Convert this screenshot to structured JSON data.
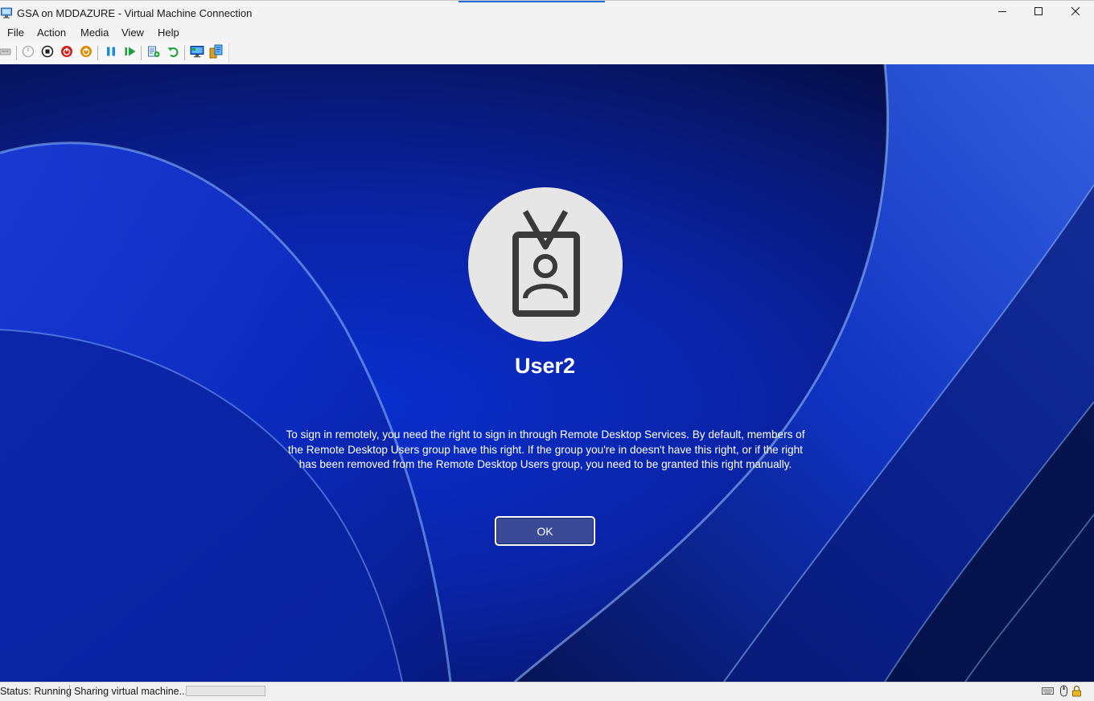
{
  "window": {
    "title": "GSA on MDDAZURE - Virtual Machine Connection",
    "controls": [
      "minimize-icon",
      "maximize-icon",
      "close-icon"
    ]
  },
  "menu": {
    "items": [
      "File",
      "Action",
      "Media",
      "View",
      "Help"
    ]
  },
  "toolbar": {
    "buttons": [
      {
        "icon": "ctrl-alt-del-icon",
        "enabled": false
      },
      {
        "icon": "start-icon",
        "enabled": false
      },
      {
        "icon": "turn-off-icon",
        "color": "#1a1a1a"
      },
      {
        "icon": "shut-down-icon",
        "color": "#d11f1f"
      },
      {
        "icon": "save-icon",
        "color": "#e08a00"
      },
      {
        "icon": "pause-icon",
        "color": "#1f8bd6"
      },
      {
        "icon": "resume-icon",
        "color": "#1aa33a"
      },
      {
        "icon": "checkpoint-icon",
        "color": "#1aa33a"
      },
      {
        "icon": "revert-icon",
        "color": "#1aa33a"
      },
      {
        "icon": "enhanced-session-icon",
        "color": "#1f6fd0"
      },
      {
        "icon": "share-icon",
        "color": "#d8a020"
      }
    ]
  },
  "vm_screen": {
    "user_name": "User2",
    "message": "To sign in remotely, you need the right to sign in through Remote Desktop Services. By default, members of the Remote Desktop Users group have this right. If the group you're in doesn't have this right, or if the right has been removed from the Remote Desktop Users group, you need to be granted this right manually.",
    "ok_label": "OK",
    "avatar_icon": "id-badge-icon"
  },
  "status": {
    "state": "Status: Running",
    "activity": "Sharing virtual machine...",
    "progress": 0,
    "tray_icons": [
      "keyboard-icon",
      "mouse-icon",
      "lock-icon"
    ]
  },
  "colors": {
    "accent": "#1f6fd0",
    "wallpaper_deep": "#061152",
    "wallpaper_bright": "#0a2fcf",
    "ok_button": "#3a4a96"
  }
}
